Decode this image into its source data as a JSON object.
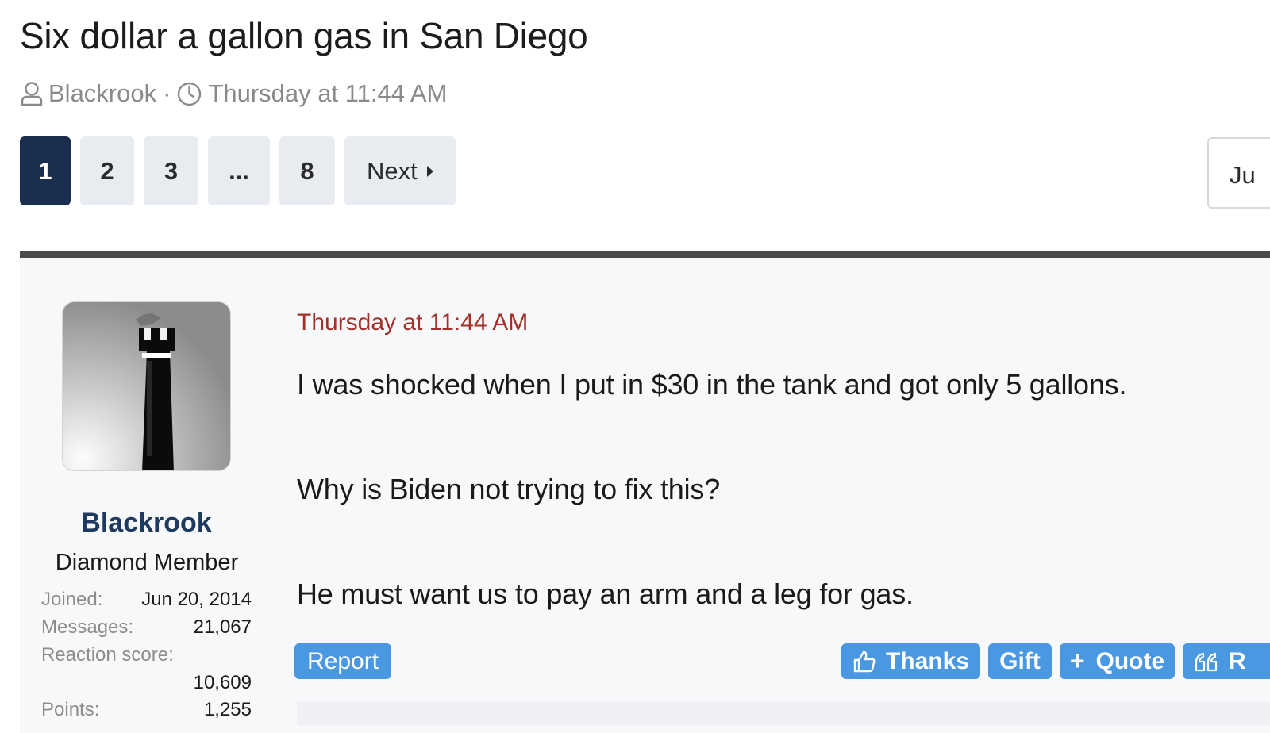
{
  "thread": {
    "title": "Six dollar a gallon gas in San Diego",
    "author": "Blackrook",
    "separator": "·",
    "date": "Thursday at 11:44 AM"
  },
  "pagination": {
    "pages": [
      "1",
      "2",
      "3",
      "...",
      "8"
    ],
    "current": "1",
    "next_label": "Next",
    "jump_label_partial": "Ju"
  },
  "post": {
    "user": {
      "name": "Blackrook",
      "title": "Diamond Member",
      "stats": [
        {
          "label": "Joined:",
          "value": "Jun 20, 2014"
        },
        {
          "label": "Messages:",
          "value": "21,067"
        },
        {
          "label": "Reaction score:",
          "value": "10,609"
        },
        {
          "label": "Points:",
          "value": "1,255"
        }
      ]
    },
    "date": "Thursday at 11:44 AM",
    "body": [
      "I was shocked when I put in $30 in the tank and got only 5 gallons.",
      "Why is Biden not trying to fix this?",
      "He must want us to pay an arm and a leg for gas."
    ],
    "actions": {
      "report": "Report",
      "thanks": "Thanks",
      "gift": "Gift",
      "quote_plus": "+",
      "quote": "Quote",
      "reply_partial": "R"
    }
  },
  "colors": {
    "accent_button": "#4a97e2",
    "active_page": "#1b2e4f",
    "username": "#1f3a5f",
    "post_date": "#a4302a"
  },
  "icons": {
    "author": "user-icon",
    "date": "clock-icon",
    "next": "caret-right-icon",
    "thanks": "thumbs-up-icon",
    "reply": "quote-marks-icon"
  }
}
